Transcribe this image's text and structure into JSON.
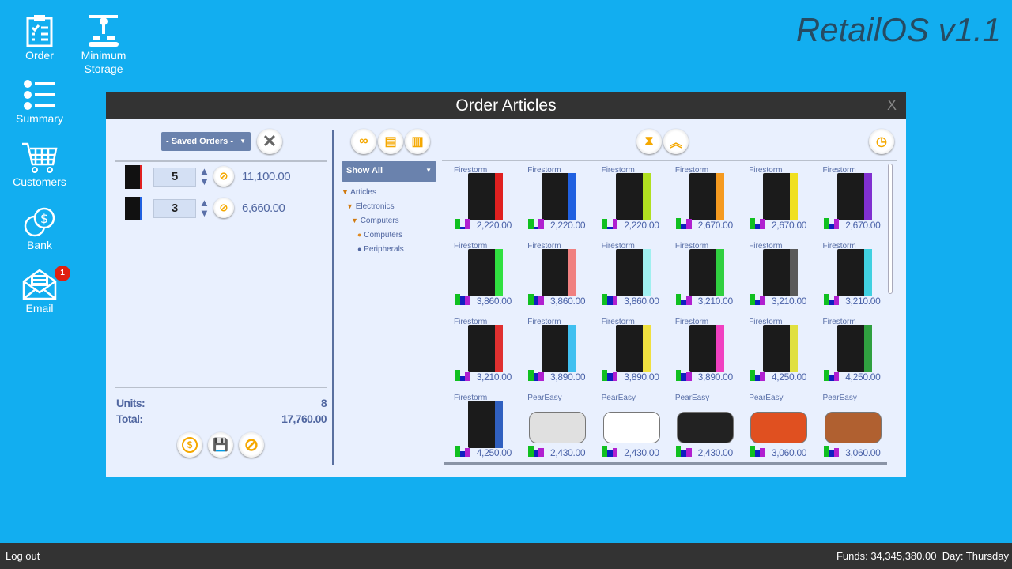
{
  "desktop": {
    "icons": [
      {
        "label": "Order"
      },
      {
        "label": "Minimum Storage"
      },
      {
        "label": "Summary"
      },
      {
        "label": "Customers"
      },
      {
        "label": "Bank"
      },
      {
        "label": "Email",
        "badge": "1"
      }
    ],
    "brand": "RetailOS v1.1"
  },
  "window": {
    "title": "Order Articles",
    "close": "X"
  },
  "order": {
    "saved_orders": "- Saved Orders -",
    "lines": [
      {
        "qty": "5",
        "amount": "11,100.00",
        "accent": "#e02020"
      },
      {
        "qty": "3",
        "amount": "6,660.00",
        "accent": "#2060e0"
      }
    ],
    "units_label": "Units:",
    "units": "8",
    "total_label": "Total:",
    "total": "17,760.00"
  },
  "filter": {
    "value": "Show All"
  },
  "tree": [
    {
      "label": "Articles",
      "type": "open"
    },
    {
      "label": "Electronics",
      "type": "open"
    },
    {
      "label": "Computers",
      "type": "open"
    },
    {
      "label": "Computers",
      "type": "leaf",
      "color": "#e08a20"
    },
    {
      "label": "Peripherals",
      "type": "leaf",
      "color": "#5066a0"
    }
  ],
  "products": [
    {
      "brand": "Firestorm",
      "price": "2,220.00",
      "accent": "#e02020",
      "stock": [
        0.9,
        0.2,
        0.9
      ]
    },
    {
      "brand": "Firestorm",
      "price": "2,220.00",
      "accent": "#2060e0",
      "stock": [
        0.9,
        0.2,
        0.9
      ]
    },
    {
      "brand": "Firestorm",
      "price": "2,220.00",
      "accent": "#b0e020",
      "stock": [
        0.9,
        0.2,
        0.9
      ]
    },
    {
      "brand": "Firestorm",
      "price": "2,670.00",
      "accent": "#f59a20",
      "stock": [
        1,
        0.4,
        0.9
      ]
    },
    {
      "brand": "Firestorm",
      "price": "2,670.00",
      "accent": "#f0e020",
      "stock": [
        1,
        0.4,
        0.9
      ]
    },
    {
      "brand": "Firestorm",
      "price": "2,670.00",
      "accent": "#8030d0",
      "stock": [
        1,
        0.4,
        0.9
      ]
    },
    {
      "brand": "Firestorm",
      "price": "3,860.00",
      "accent": "#30e040",
      "stock": [
        1,
        0.8,
        0.8
      ]
    },
    {
      "brand": "Firestorm",
      "price": "3,860.00",
      "accent": "#f08080",
      "stock": [
        1,
        0.8,
        0.8
      ]
    },
    {
      "brand": "Firestorm",
      "price": "3,860.00",
      "accent": "#a0f0f0",
      "stock": [
        1,
        0.8,
        0.8
      ]
    },
    {
      "brand": "Firestorm",
      "price": "3,210.00",
      "accent": "#30d040",
      "stock": [
        1,
        0.4,
        0.8
      ]
    },
    {
      "brand": "Firestorm",
      "price": "3,210.00",
      "accent": "#5a5a5a",
      "stock": [
        1,
        0.4,
        0.8
      ]
    },
    {
      "brand": "Firestorm",
      "price": "3,210.00",
      "accent": "#40d0e0",
      "stock": [
        1,
        0.4,
        0.8
      ]
    },
    {
      "brand": "Firestorm",
      "price": "3,210.00",
      "accent": "#e03030",
      "stock": [
        1,
        0.4,
        0.8
      ]
    },
    {
      "brand": "Firestorm",
      "price": "3,890.00",
      "accent": "#40c0f0",
      "stock": [
        1,
        0.7,
        0.8
      ]
    },
    {
      "brand": "Firestorm",
      "price": "3,890.00",
      "accent": "#f0e040",
      "stock": [
        1,
        0.7,
        0.8
      ]
    },
    {
      "brand": "Firestorm",
      "price": "3,890.00",
      "accent": "#f040c0",
      "stock": [
        1,
        0.7,
        0.8
      ]
    },
    {
      "brand": "Firestorm",
      "price": "4,250.00",
      "accent": "#e0e040",
      "stock": [
        1,
        0.5,
        0.8
      ]
    },
    {
      "brand": "Firestorm",
      "price": "4,250.00",
      "accent": "#30a040",
      "stock": [
        1,
        0.5,
        0.8
      ]
    },
    {
      "brand": "Firestorm",
      "price": "4,250.00",
      "accent": "#3060c0",
      "stock": [
        1,
        0.5,
        0.8
      ]
    },
    {
      "brand": "PearEasy",
      "price": "2,430.00",
      "accent": "#e0e0e0",
      "stock": [
        1,
        0.6,
        0.8
      ]
    },
    {
      "brand": "PearEasy",
      "price": "2,430.00",
      "accent": "#ffffff",
      "stock": [
        1,
        0.6,
        0.8
      ]
    },
    {
      "brand": "PearEasy",
      "price": "2,430.00",
      "accent": "#222222",
      "stock": [
        1,
        0.6,
        0.8
      ]
    },
    {
      "brand": "PearEasy",
      "price": "3,060.00",
      "accent": "#e05020",
      "stock": [
        1,
        0.6,
        0.8
      ]
    },
    {
      "brand": "PearEasy",
      "price": "3,060.00",
      "accent": "#b06030",
      "stock": [
        1,
        0.6,
        0.8
      ]
    }
  ],
  "footer": {
    "logout": "Log out",
    "funds": "Funds: 34,345,380.00",
    "day": "Day: Thursday"
  }
}
